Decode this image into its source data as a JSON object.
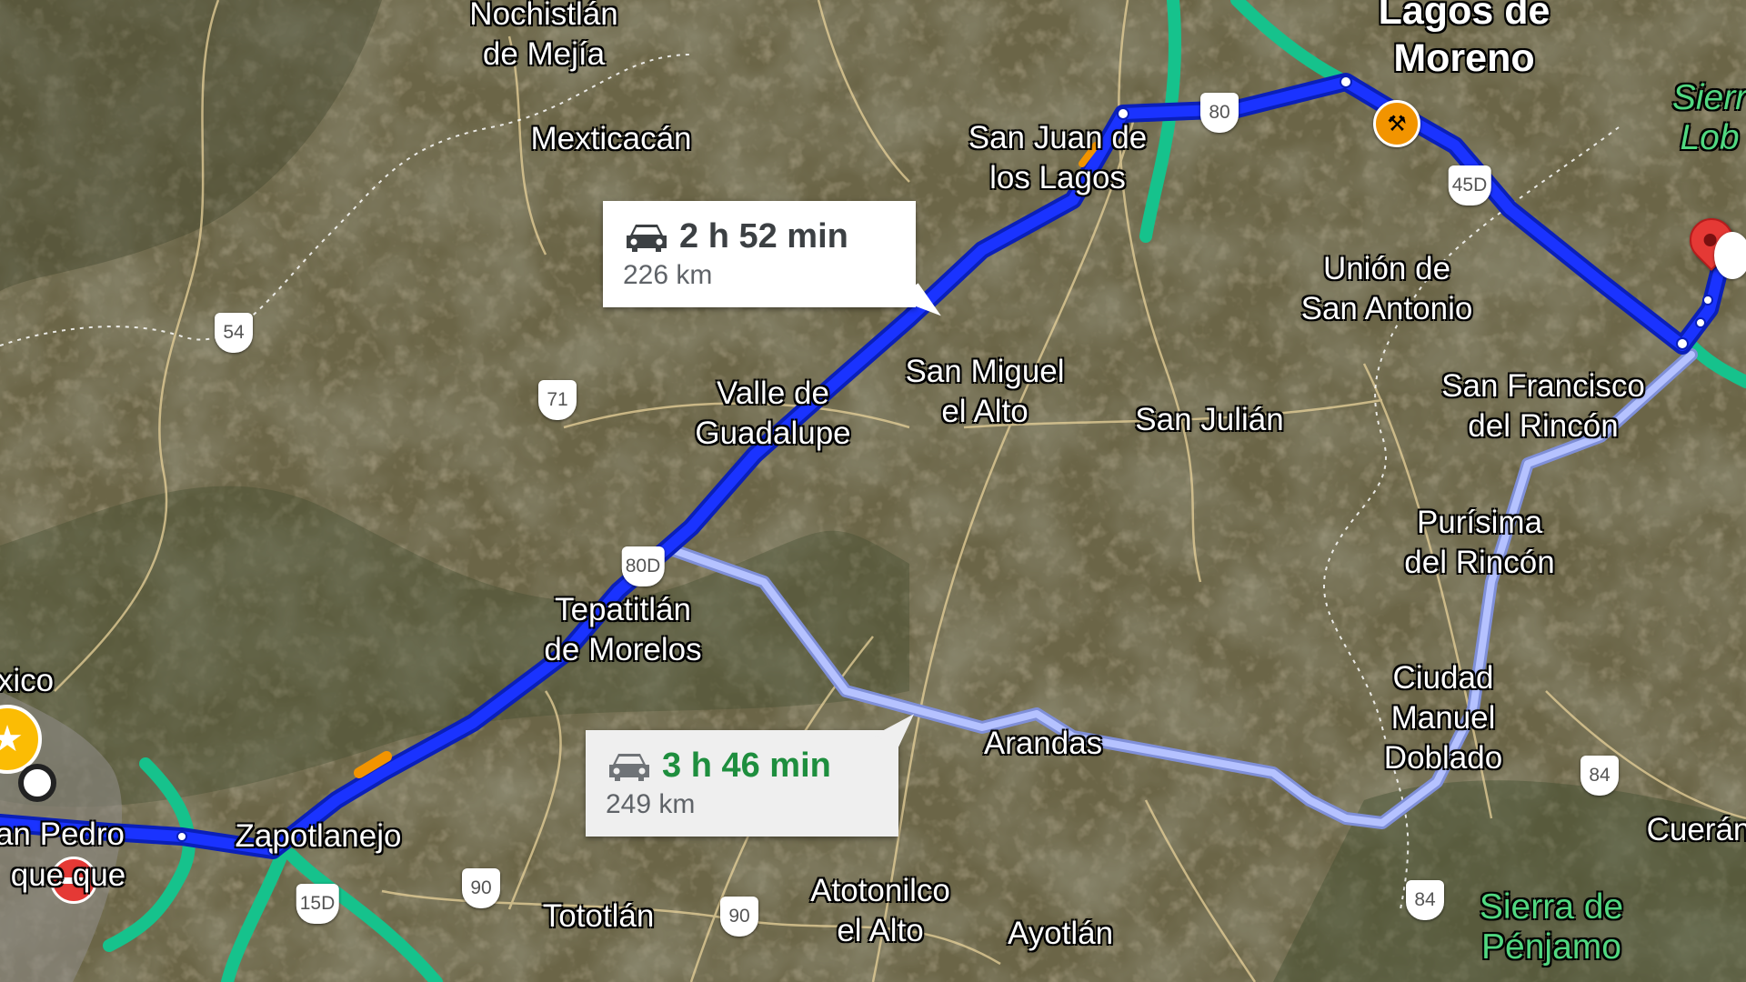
{
  "map": {
    "colors": {
      "terrain": "#5e5a3e",
      "main_route": "#1a33ff",
      "main_route_outline": "#0a1fb8",
      "alt_route": "#aab8ff",
      "alt_route_outline": "#7f8fd8",
      "highway": "#16c28c",
      "traffic_slow": "#f29400",
      "destination_pin": "#e53935"
    },
    "places": {
      "nochistlan": [
        "Nochistlán",
        "de Mejía"
      ],
      "mexticacan": [
        "Mexticacán"
      ],
      "lagos_de_moreno": [
        "Lagos de",
        "Moreno"
      ],
      "san_juan_de_los_lagos": [
        "San Juan de",
        "los Lagos"
      ],
      "union_de_san_antonio": [
        "Unión de",
        "San Antonio"
      ],
      "san_miguel_el_alto": [
        "San Miguel",
        "el Alto"
      ],
      "san_julian": [
        "San Julián"
      ],
      "valle_de_guadalupe": [
        "Valle de",
        "Guadalupe"
      ],
      "san_francisco_del_rincon": [
        "San Francisco",
        "del Rincón"
      ],
      "purisima_del_rincon": [
        "Purísima",
        "del Rincón"
      ],
      "tepatitlan": [
        "Tepatitlán",
        "de Morelos"
      ],
      "ciudad_manuel_doblado": [
        "Ciudad",
        "Manuel",
        "Doblado"
      ],
      "arandas": [
        "Arandas"
      ],
      "zapotlanejo": [
        "Zapotlanejo"
      ],
      "san_pedro": [
        "an Pedro"
      ],
      "tlaquepaque": [
        "que  que"
      ],
      "xico": [
        "xico"
      ],
      "atotonilco": [
        "Atotonilco",
        "el Alto"
      ],
      "tototlan": [
        "Tototlán"
      ],
      "ayotlan": [
        "Ayotlán"
      ],
      "cueran": [
        "Cuerán"
      ],
      "sierra_de_penjamo": [
        "Sierra de",
        "Pénjamo"
      ],
      "sierra_lobos": [
        "Sierr",
        "Lob"
      ]
    },
    "shields": {
      "s54": "54",
      "s71": "71",
      "s80": "80",
      "s45d": "45D",
      "s80d": "80D",
      "s15d": "15D",
      "s90a": "90",
      "s90b": "90",
      "s84a": "84",
      "s84b": "84"
    }
  },
  "routes": {
    "main": {
      "time": "2 h 52 min",
      "distance": "226 km",
      "icon": "car-icon"
    },
    "alternate": {
      "time": "3 h 46 min",
      "distance": "249 km",
      "icon": "car-icon"
    }
  }
}
